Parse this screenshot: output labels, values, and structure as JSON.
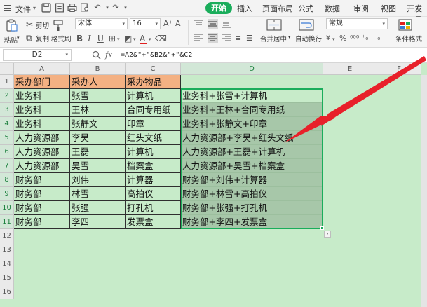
{
  "menubar": {
    "file_label": "文件",
    "tabs": [
      {
        "label": "开始",
        "active": true
      },
      {
        "label": "插入"
      },
      {
        "label": "页面布局"
      },
      {
        "label": "公式"
      },
      {
        "label": "数据"
      },
      {
        "label": "审阅"
      },
      {
        "label": "视图"
      },
      {
        "label": "开发工具"
      }
    ]
  },
  "ribbon": {
    "paste_label": "粘贴",
    "cut_label": "剪切",
    "copy_label": "复制",
    "format_painter_label": "格式刷",
    "font_name": "宋体",
    "font_size": "16",
    "merge_label": "合并居中",
    "wrap_label": "自动换行",
    "number_format": "常规",
    "cond_format_label": "条件格式",
    "accent_color": "#1aad5b",
    "font_color": "#e02020"
  },
  "formula_bar": {
    "name_box": "D2",
    "fx_label": "fx",
    "formula": "=A2&\"+\"&B2&\"+\"&C2"
  },
  "sheet": {
    "columns": [
      "A",
      "B",
      "C",
      "D",
      "E",
      "F"
    ],
    "rows": [
      "1",
      "2",
      "3",
      "4",
      "5",
      "6",
      "7",
      "8",
      "9",
      "10",
      "11",
      "12",
      "13",
      "14",
      "15",
      "16"
    ],
    "headers": [
      "采办部门",
      "采办人",
      "采办物品"
    ],
    "data": [
      [
        "业务科",
        "张雪",
        "计算机",
        "业务科+张雪+计算机"
      ],
      [
        "业务科",
        "王林",
        "合同专用纸",
        "业务科+王林+合同专用纸"
      ],
      [
        "业务科",
        "张静文",
        "印章",
        "业务科+张静文+印章"
      ],
      [
        "人力资源部",
        "李昊",
        "红头文纸",
        "人力资源部+李昊+红头文纸"
      ],
      [
        "人力资源部",
        "王磊",
        "计算机",
        "人力资源部+王磊+计算机"
      ],
      [
        "人力资源部",
        "吴雪",
        "档案盒",
        "人力资源部+吴雪+档案盒"
      ],
      [
        "财务部",
        "刘伟",
        "计算器",
        "财务部+刘伟+计算器"
      ],
      [
        "财务部",
        "林雪",
        "高拍仪",
        "财务部+林雪+高拍仪"
      ],
      [
        "财务部",
        "张强",
        "打孔机",
        "财务部+张强+打孔机"
      ],
      [
        "财务部",
        "李四",
        "发票盒",
        "财务部+李四+发票盒"
      ]
    ],
    "header_fill": "#f4b183",
    "grid_fill": "#c7ebc9",
    "selection_color": "#1aad5b",
    "arrow_color": "#e8202a"
  }
}
